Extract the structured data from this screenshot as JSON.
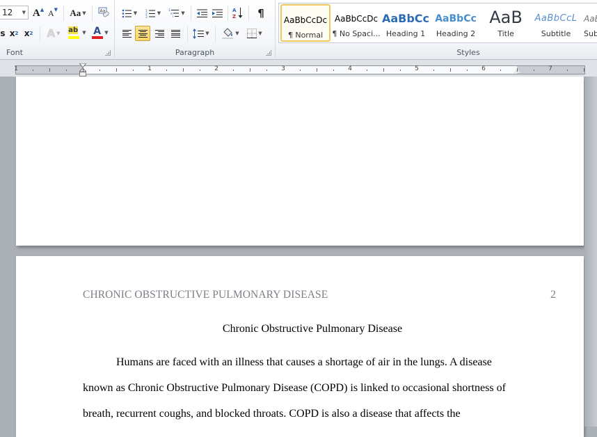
{
  "ribbon": {
    "font_group": {
      "label": "Font",
      "font_size": "12",
      "grow_font": "A",
      "shrink_font": "A",
      "change_case": "Aa",
      "clear_formatting_icon": "clear-formatting-icon",
      "bold_partial": "s",
      "subscript": "x",
      "subscript_mark": "2",
      "superscript": "x",
      "superscript_mark": "2",
      "text_effects": "A",
      "highlight": "ab",
      "font_color": "A",
      "highlight_color": "#ffff00",
      "font_color_value": "#e02020"
    },
    "paragraph_group": {
      "label": "Paragraph",
      "pilcrow": "¶",
      "sort": "A Z"
    },
    "styles_group": {
      "label": "Styles",
      "items": [
        {
          "sample": "AaBbCcDc",
          "name": "¶ Normal",
          "selected": true
        },
        {
          "sample": "AaBbCcDc",
          "name": "¶ No Spaci...",
          "selected": false
        },
        {
          "sample": "AaBbCc",
          "name": "Heading 1",
          "selected": false
        },
        {
          "sample": "AaBbCc",
          "name": "Heading 2",
          "selected": false
        },
        {
          "sample": "AaB",
          "name": "Title",
          "selected": false
        },
        {
          "sample": "AaBbCcL",
          "name": "Subtitle",
          "selected": false
        },
        {
          "sample": "AaBl",
          "name": "Sub",
          "selected": false
        }
      ]
    }
  },
  "ruler": {
    "numbers": [
      "1",
      "1",
      "2",
      "3",
      "4",
      "5",
      "6",
      "7"
    ]
  },
  "document": {
    "running_head": "CHRONIC OBSTRUCTIVE PULMONARY DISEASE",
    "page_number": "2",
    "title": "Chronic Obstructive Pulmonary Disease",
    "lines": [
      "Humans are faced with an illness that causes a shortage of air in the lungs. A disease",
      "known as Chronic Obstructive Pulmonary Disease (COPD) is linked to occasional shortness of",
      "breath, recurrent coughs, and blocked throats. COPD is also a disease that affects the"
    ]
  }
}
